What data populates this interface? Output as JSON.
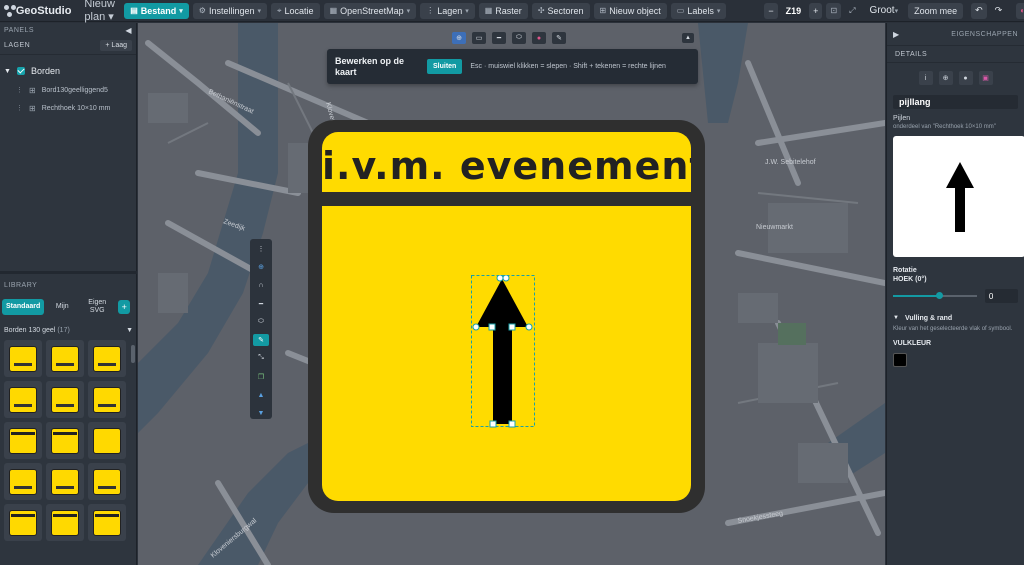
{
  "app": {
    "brand": "GeoStudio",
    "plan_name": "Nieuw plan",
    "plan_caret": "▾"
  },
  "toolbar": {
    "bestand": "Bestand",
    "instellingen": "Instellingen",
    "locatie": "Locatie",
    "basemap": "OpenStreetMap",
    "lagen": "Lagen",
    "raster": "Raster",
    "sectoren": "Sectoren",
    "nieuw_object": "Nieuw object",
    "labels": "Labels",
    "zoom_minus": "−",
    "zoom_level": "Z19",
    "zoom_plus": "+",
    "size_value": "Groot",
    "zoom_mee": "Zoom mee",
    "undo": "↶",
    "redo": "↷"
  },
  "left_panel": {
    "panels_label": "PANELS",
    "lagen_label": "LAGEN",
    "add_layer": "+ Laag",
    "group_name": "Borden",
    "items": [
      {
        "label": "Bord130geelliggend5"
      },
      {
        "label": "Rechthoek 10×10 mm"
      }
    ],
    "library_label": "LIBRARY",
    "tabs": [
      {
        "label": "Standaard"
      },
      {
        "label": "Mijn"
      },
      {
        "label": "Eigen SVG"
      }
    ],
    "lib_add": "+",
    "group": "Borden 130 geel",
    "group_count": "(17)"
  },
  "map": {
    "edit_title": "Bewerken op de kaart",
    "close_label": "Sluiten",
    "edit_hint": "Esc · muiswiel klikken = slepen · Shift + tekenen = rechte lijnen",
    "streets": [
      {
        "label": "Bethaniënstraat"
      },
      {
        "label": "Kloveniersburgwal"
      },
      {
        "label": "Zeedijk"
      },
      {
        "label": "Nieuwmarkt"
      },
      {
        "label": "J.W. Sebitelehof"
      },
      {
        "label": "Snoekjessteeg"
      },
      {
        "label": "Kloveniersburgwal"
      }
    ],
    "sign": {
      "text": "i.v.m. evenement",
      "bg_color": "#ffdb00",
      "frame_color": "#2f2f2f"
    }
  },
  "right_panel": {
    "eigenschappen": "EIGENSCHAPPEN",
    "details": "DETAILS",
    "object_name": "pijllang",
    "category": "Pijlen",
    "sub": "onderdeel van \"Rechthoek 10×10 mm\"",
    "rotatie": "Rotatie",
    "hoek_label": "HOEK (0°)",
    "hoek_value": "0",
    "hoek_fraction": 0.5,
    "fill_section": "Vulling & rand",
    "fill_hint": "Kleur van het geselecteerde vlak of symbool.",
    "vulkleur": "VULKLEUR",
    "fill_color": "#000000"
  }
}
